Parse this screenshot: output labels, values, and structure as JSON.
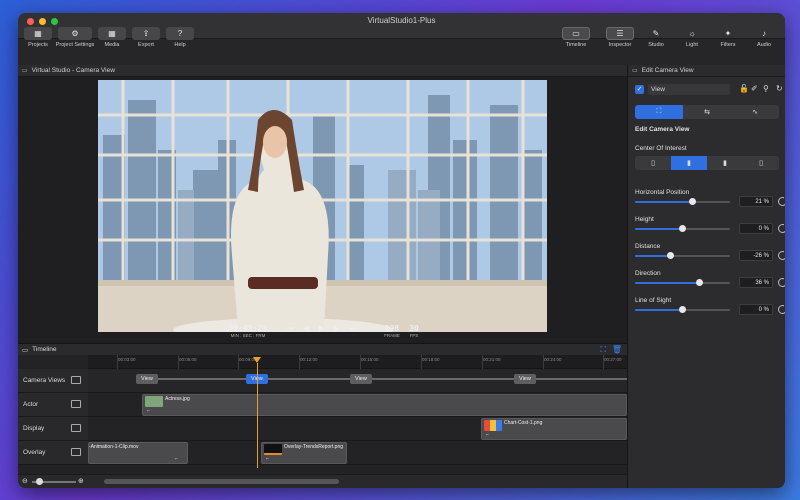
{
  "window": {
    "title": "VirtualStudio1-Plus"
  },
  "toolbar": {
    "left": [
      {
        "label": "Projects",
        "icon": "grid-icon"
      },
      {
        "label": "Project Settings",
        "icon": "gear-icon"
      },
      {
        "label": "Media",
        "icon": "media-grid-icon"
      },
      {
        "label": "Export",
        "icon": "share-icon"
      },
      {
        "label": "Help",
        "icon": "question-icon"
      }
    ],
    "right": [
      {
        "label": "Timeline",
        "icon": "timeline-icon"
      },
      {
        "label": "Inspector",
        "icon": "sliders-icon"
      },
      {
        "label": "Studio",
        "icon": "brush-icon"
      },
      {
        "label": "Light",
        "icon": "light-icon"
      },
      {
        "label": "Filters",
        "icon": "sparkle-icon"
      },
      {
        "label": "Audio",
        "icon": "speaker-icon"
      }
    ]
  },
  "viewer": {
    "title": "Virtual Studio - Camera View",
    "timecode": "00:09:28",
    "timecode_sub": "MIN : SEC : FRM",
    "frame": "298",
    "frame_label": "FRAME",
    "fps": "30",
    "fps_label": "FPS"
  },
  "timeline": {
    "title": "Timeline",
    "ticks": [
      "00:03:00",
      "00:06:00",
      "00:09:00",
      "00:12:00",
      "00:15:00",
      "00:18:00",
      "00:21:00",
      "00:24:00",
      "00:27:00"
    ],
    "tracks": [
      "Camera Views",
      "Actor",
      "Display",
      "Overlay"
    ],
    "view_label": "View",
    "clips": {
      "actor": "Actress.jpg",
      "display": "Chart-Cost-1.png",
      "overlay1": "-Animation-1-Clip.mov",
      "overlay2": "Overlay-TrendsReport.png"
    }
  },
  "inspector": {
    "panel_title": "Edit Camera View",
    "view_field": "View",
    "section_title": "Edit Camera View",
    "center_of_interest": "Center Of Interest",
    "params": [
      {
        "label": "Horizontal Position",
        "value": "21 %",
        "level": 0.6
      },
      {
        "label": "Height",
        "value": "0 %",
        "level": 0.5
      },
      {
        "label": "Distance",
        "value": "-26 %",
        "level": 0.37
      },
      {
        "label": "Direction",
        "value": "36 %",
        "level": 0.68
      },
      {
        "label": "Line of Sight",
        "value": "0 %",
        "level": 0.5
      }
    ]
  },
  "colors": {
    "accent": "#2f6fe0",
    "playhead": "#e5a227"
  }
}
